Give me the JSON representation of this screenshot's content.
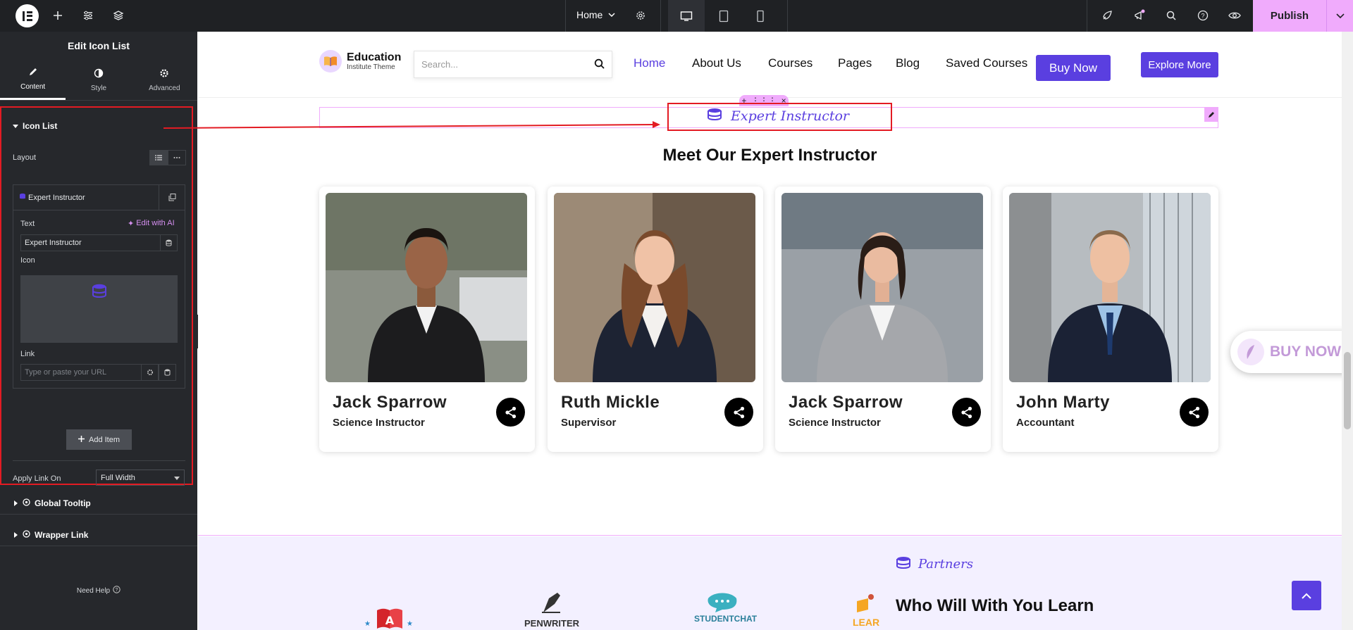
{
  "topbar": {
    "page_name": "Home",
    "publish_label": "Publish"
  },
  "panel": {
    "title": "Edit Icon List",
    "tabs": [
      {
        "label": "Content",
        "icon": "pencil-icon",
        "active": true
      },
      {
        "label": "Style",
        "icon": "half-circle-icon",
        "active": false
      },
      {
        "label": "Advanced",
        "icon": "gear-icon",
        "active": false
      }
    ],
    "section_icon_list": "Icon List",
    "layout_label": "Layout",
    "item_title": "Expert Instructor",
    "text_label": "Text",
    "edit_with_ai": "Edit with AI",
    "text_value": "Expert Instructor",
    "icon_label": "Icon",
    "link_label": "Link",
    "link_placeholder": "Type or paste your URL",
    "add_item": "Add Item",
    "apply_link_label": "Apply Link On",
    "apply_link_value": "Full Width",
    "global_tooltip": "Global Tooltip",
    "wrapper_link": "Wrapper Link",
    "need_help": "Need Help"
  },
  "site": {
    "brand_name": "Education",
    "brand_sub": "Institute Theme",
    "search_placeholder": "Search...",
    "nav": [
      {
        "label": "Home",
        "active": true
      },
      {
        "label": "About Us",
        "active": false
      },
      {
        "label": "Courses",
        "active": false
      },
      {
        "label": "Pages",
        "active": false
      },
      {
        "label": "Blog",
        "active": false
      },
      {
        "label": "Saved Courses",
        "active": false
      }
    ],
    "buy_now": "Buy Now",
    "explore_more": "Explore More",
    "section_subtitle": "Expert Instructor",
    "section_heading": "Meet Our Expert Instructor",
    "instructors": [
      {
        "name": "Jack Sparrow",
        "role": "Science Instructor"
      },
      {
        "name": "Ruth Mickle",
        "role": "Supervisor"
      },
      {
        "name": "Jack Sparrow",
        "role": "Science Instructor"
      },
      {
        "name": "John Marty",
        "role": "Accountant"
      }
    ],
    "float_buy_now": "BUY NOW",
    "partners_subtitle": "Partners",
    "partners_heading": "Who Will With You Learn",
    "partner_logos": [
      "PENWRITER",
      "STUDENTCHAT",
      "LEAR"
    ]
  },
  "colors": {
    "accent": "#5a3fe0",
    "editor_pink": "#f0abfc",
    "annotation_red": "#e31b23",
    "panel_bg": "#26282c"
  }
}
